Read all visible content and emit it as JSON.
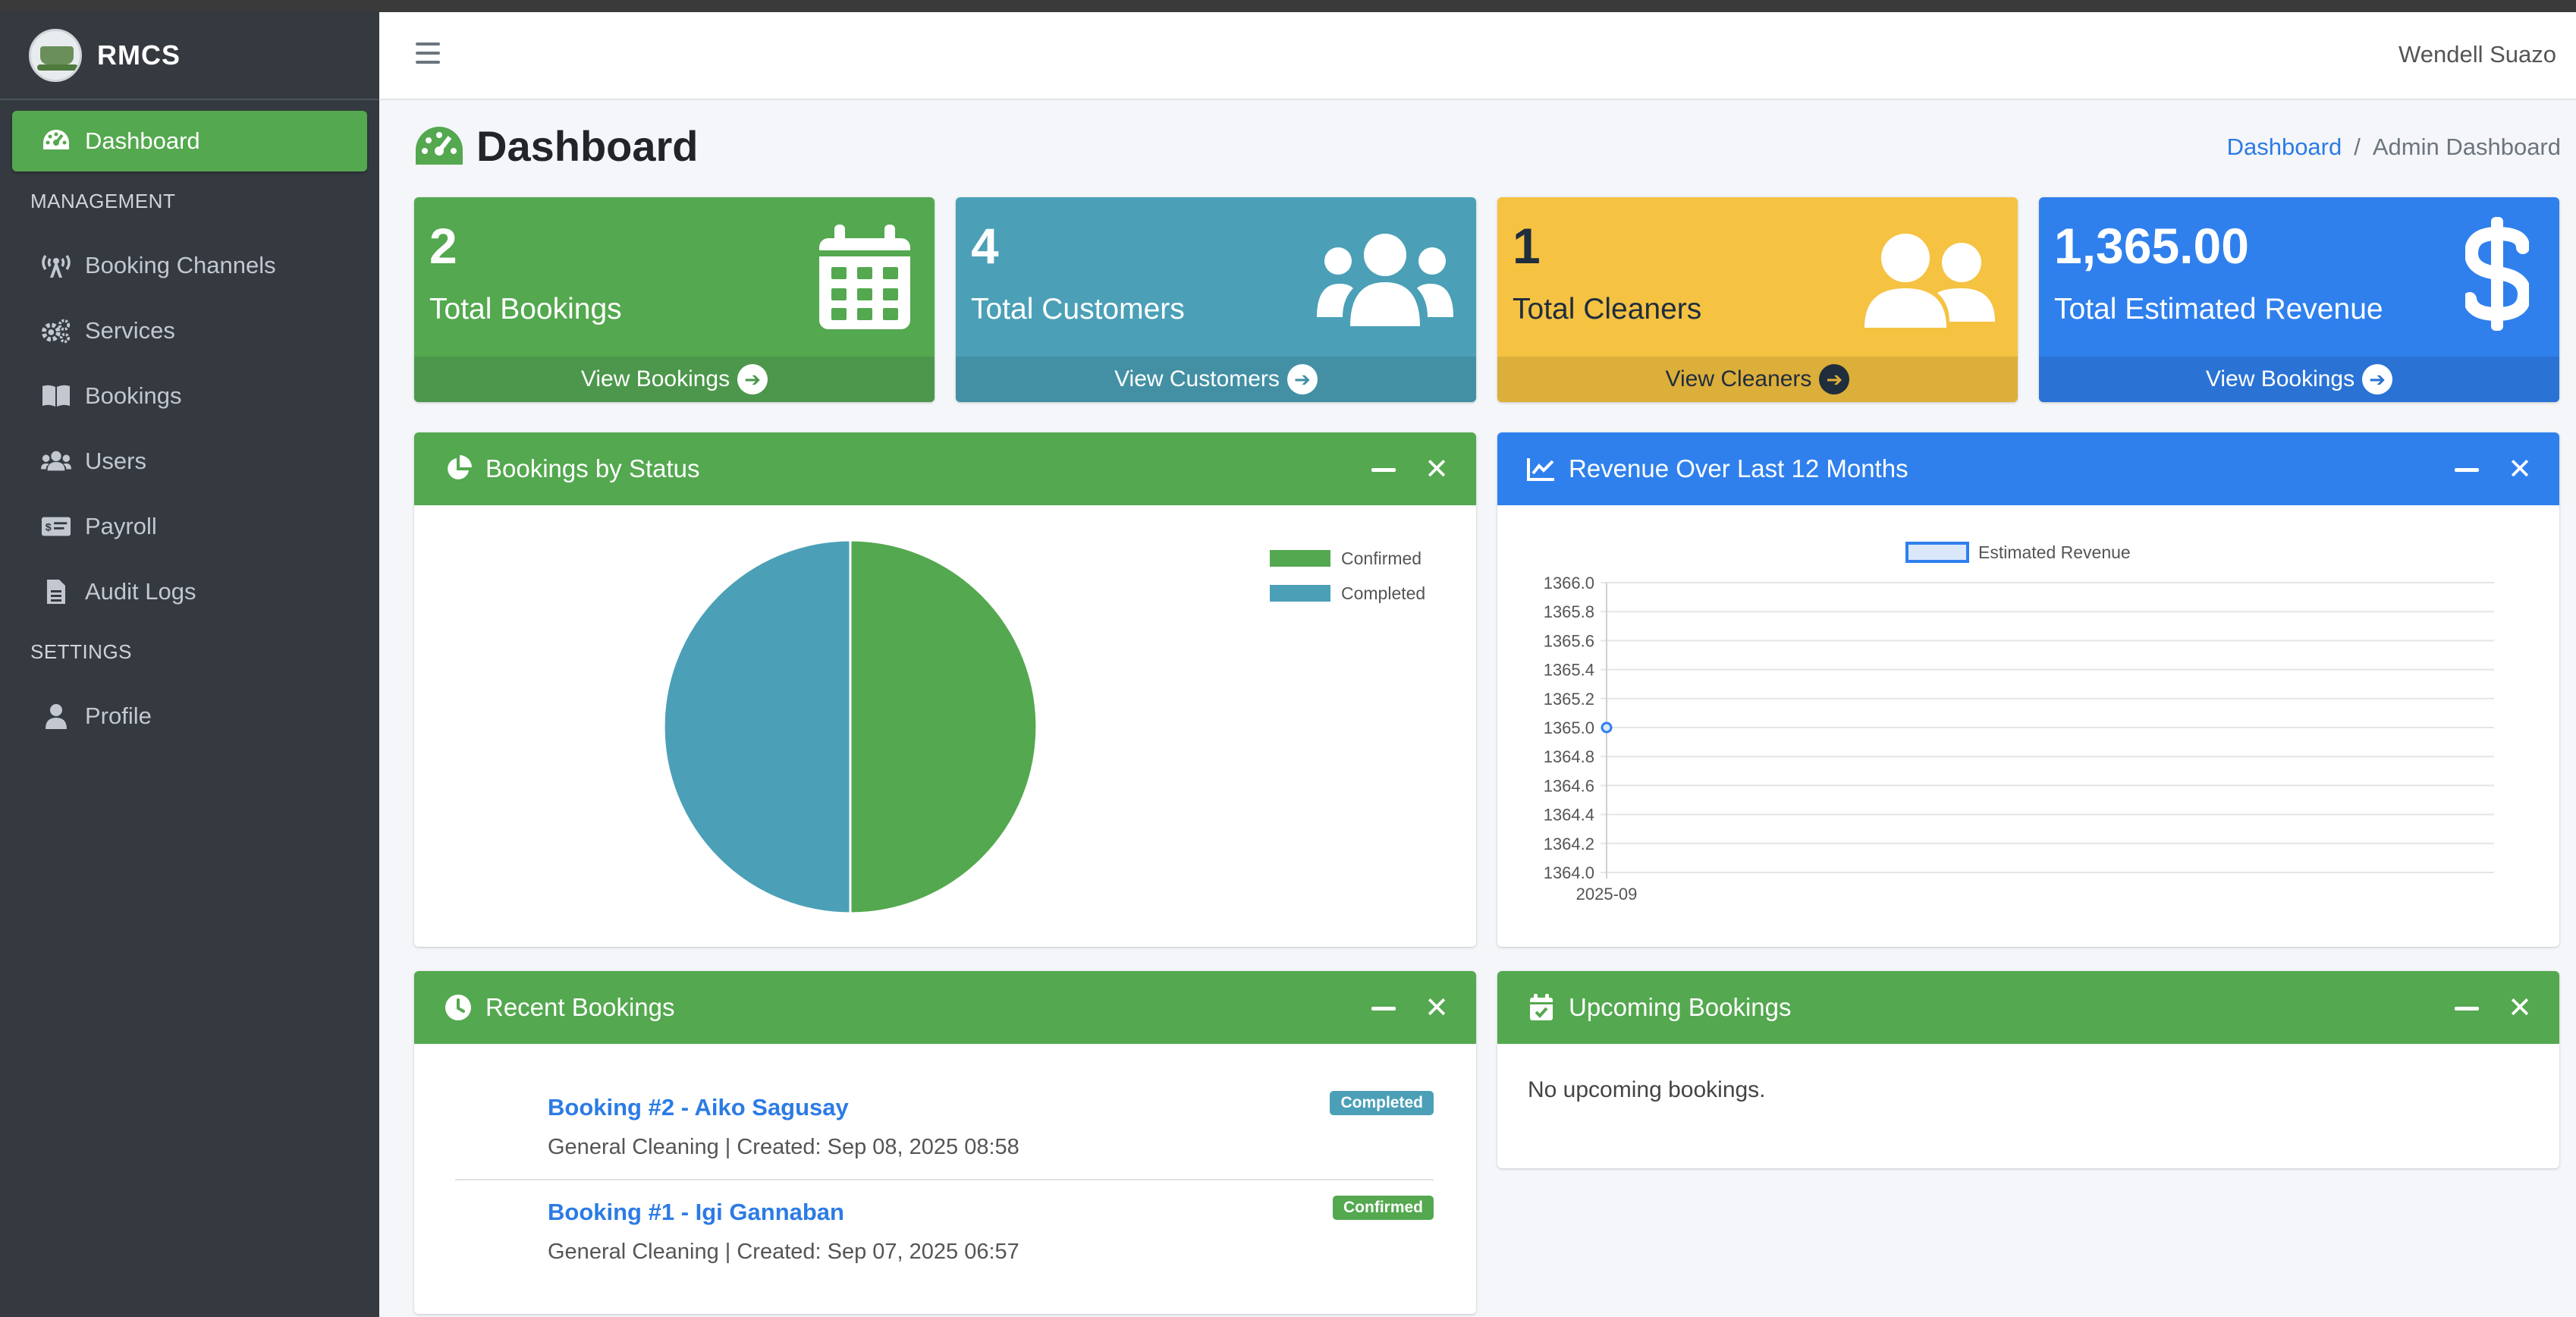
{
  "app": {
    "brand": "RMCS",
    "user": "Wendell Suazo"
  },
  "sidebar": {
    "items": [
      {
        "label": "Dashboard",
        "icon": "tachometer-icon",
        "active": true
      },
      {
        "header": "MANAGEMENT"
      },
      {
        "label": "Booking Channels",
        "icon": "broadcast-tower-icon"
      },
      {
        "label": "Services",
        "icon": "cogs-icon"
      },
      {
        "label": "Bookings",
        "icon": "book-icon"
      },
      {
        "label": "Users",
        "icon": "users-icon"
      },
      {
        "label": "Payroll",
        "icon": "money-check-icon"
      },
      {
        "label": "Audit Logs",
        "icon": "file-icon"
      },
      {
        "header": "SETTINGS"
      },
      {
        "label": "Profile",
        "icon": "user-icon"
      }
    ]
  },
  "page": {
    "title": "Dashboard",
    "breadcrumb": {
      "home": "Dashboard",
      "separator": "/",
      "current": "Admin Dashboard"
    }
  },
  "stats": [
    {
      "value": "2",
      "label": "Total Bookings",
      "link": "View Bookings",
      "color": "#54a84f",
      "icon": "calendar-icon"
    },
    {
      "value": "4",
      "label": "Total Customers",
      "link": "View Customers",
      "color": "#4ba0b7",
      "icon": "users-icon"
    },
    {
      "value": "1",
      "label": "Total Cleaners",
      "link": "View Cleaners",
      "color": "#f5c242",
      "icon": "user-friends-icon"
    },
    {
      "value": "1,365.00",
      "label": "Total Estimated Revenue",
      "link": "View Bookings",
      "color": "#2f80ed",
      "icon": "dollar-icon"
    }
  ],
  "cards": {
    "status": {
      "title": "Bookings by Status"
    },
    "revenue": {
      "title": "Revenue Over Last 12 Months"
    },
    "recent": {
      "title": "Recent Bookings"
    },
    "upcoming": {
      "title": "Upcoming Bookings",
      "empty": "No upcoming bookings."
    }
  },
  "recent_bookings": [
    {
      "title": "Booking #2 - Aiko Sagusay",
      "subtitle": "General Cleaning | Created: Sep 08, 2025 08:58",
      "status": "Completed",
      "status_color": "#4ba0b7"
    },
    {
      "title": "Booking #1 - Igi Gannaban",
      "subtitle": "General Cleaning | Created: Sep 07, 2025 06:57",
      "status": "Confirmed",
      "status_color": "#54a84f"
    }
  ],
  "chart_data": [
    {
      "type": "pie",
      "title": "Bookings by Status",
      "labels": [
        "Confirmed",
        "Completed"
      ],
      "values": [
        1,
        1
      ],
      "colors": [
        "#54a84f",
        "#4ba0b7"
      ],
      "legend": "top-right"
    },
    {
      "type": "line",
      "title": "Revenue Over Last 12 Months",
      "x": [
        "2025-09"
      ],
      "series": [
        {
          "name": "Estimated Revenue",
          "values": [
            1365.0
          ],
          "color": "#2f80ed"
        }
      ],
      "ylim": [
        1364.0,
        1366.0
      ],
      "yticks": [
        "1366.0",
        "1365.8",
        "1365.6",
        "1365.4",
        "1365.2",
        "1365.0",
        "1364.8",
        "1364.6",
        "1364.4",
        "1364.2",
        "1364.0"
      ],
      "grid": true,
      "legend": "top"
    }
  ]
}
